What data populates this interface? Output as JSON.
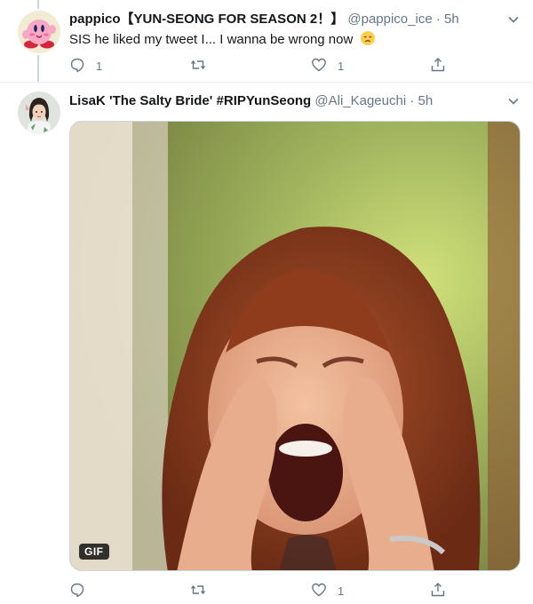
{
  "tweets": [
    {
      "display_name": "pappico【YUN-SEONG FOR SEASON 2！】",
      "handle": "@pappico_ice",
      "separator": "·",
      "time": "5h",
      "text": "SIS he liked my tweet I... I wanna be wrong now",
      "emoji_icon": "disappointed-face-icon",
      "actions": {
        "reply_count": "1",
        "retweet_count": "",
        "like_count": "1"
      }
    },
    {
      "display_name": "LisaK 'The Salty Bride' #RIPYunSeong",
      "handle": "@Ali_Kageuchi",
      "separator": "·",
      "time": "5h",
      "media_badge": "GIF",
      "actions": {
        "reply_count": "",
        "retweet_count": "",
        "like_count": "1"
      }
    }
  ],
  "colors": {
    "text_primary": "#14171a",
    "text_secondary": "#657786",
    "divider": "#e6ecf0",
    "thread_line": "#ccd6dd"
  }
}
